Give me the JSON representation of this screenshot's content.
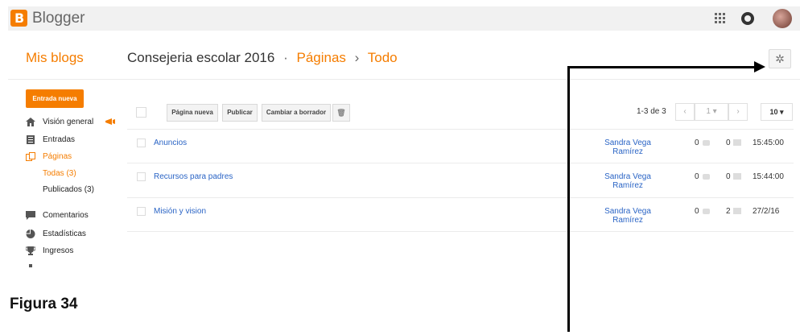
{
  "app": {
    "brand": "Blogger",
    "logo_letter": "B"
  },
  "header": {
    "my_blogs": "Mis blogs",
    "blog_name": "Consejeria escolar 2016",
    "separator": "·",
    "section": "Páginas",
    "arrow": "›",
    "filter": "Todo",
    "gear_glyph": "✲"
  },
  "sidebar": {
    "new_post": "Entrada nueva",
    "items": [
      {
        "label": "Visión general",
        "icon": "home-icon"
      },
      {
        "label": "Entradas",
        "icon": "posts-icon"
      },
      {
        "label": "Páginas",
        "icon": "pages-icon"
      },
      {
        "label": "Comentarios",
        "icon": "comment-icon"
      },
      {
        "label": "Estadísticas",
        "icon": "stats-icon"
      },
      {
        "label": "Ingresos",
        "icon": "trophy-icon"
      }
    ],
    "subitems": [
      "Todas (3)",
      "Publicados (3)"
    ]
  },
  "toolbar": {
    "new_page": "Página nueva",
    "publish": "Publicar",
    "revert": "Cambiar a borrador",
    "delete_glyph": "🗑",
    "range": "1-3 de 3",
    "prev": "‹",
    "page": "1 ▾",
    "next": "›",
    "page_size": "10 ▾"
  },
  "pages": [
    {
      "title": "Anuncios",
      "author": "Sandra Vega Ramírez",
      "comments": "0",
      "views": "0",
      "date": "15:45:00"
    },
    {
      "title": "Recursos para padres",
      "author": "Sandra Vega Ramírez",
      "comments": "0",
      "views": "0",
      "date": "15:44:00"
    },
    {
      "title": "Misión y vision",
      "author": "Sandra Vega Ramírez",
      "comments": "0",
      "views": "2",
      "date": "27/2/16"
    }
  ],
  "caption": "Figura 34",
  "colors": {
    "accent": "#f57d00",
    "link": "#2a64c5",
    "topbar": "#f1f1f1"
  }
}
